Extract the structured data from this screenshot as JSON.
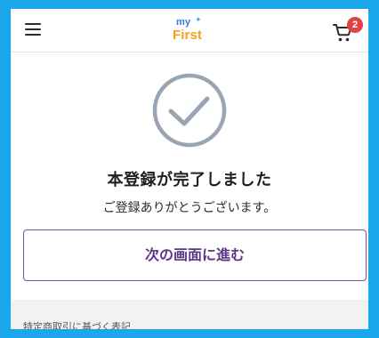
{
  "header": {
    "menu_icon": "hamburger-menu-icon",
    "logo": {
      "top": "my",
      "bottom": "First",
      "top_color": "#2f7de1",
      "bottom_color": "#f3a21d"
    },
    "cart_icon": "shopping-cart-icon",
    "cart_badge_count": "2",
    "cart_badge_color": "#e14343"
  },
  "main": {
    "status_icon": "check-circle-icon",
    "title": "本登録が完了しました",
    "message": "ご登録ありがとうございます。",
    "next_button_label": "次の画面に進む",
    "accent_color": "#5b3787"
  },
  "footer": {
    "link_label": "特定商取引に基づく表記"
  },
  "colors": {
    "frame": "#1aa7ec",
    "check_circle": "#9aa5b4"
  }
}
